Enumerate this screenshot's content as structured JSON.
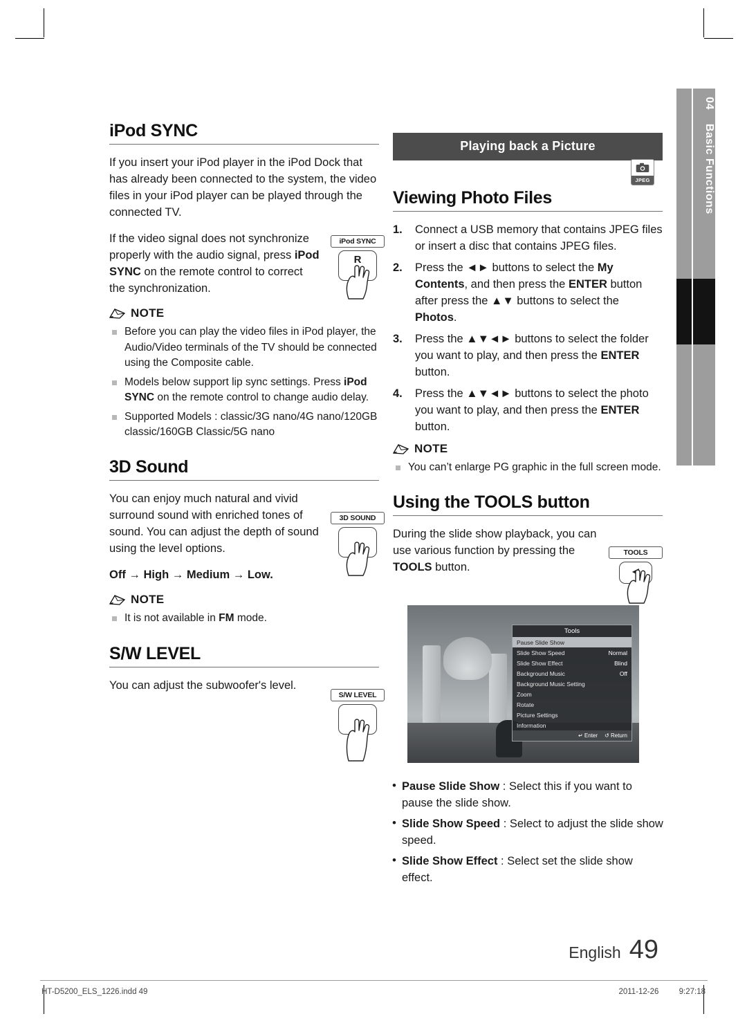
{
  "page": {
    "language_label": "English",
    "page_number": "49",
    "footer_file": "HT-D5200_ELS_1226.indd   49",
    "footer_date": "2011-12-26",
    "footer_time": "9:27:18"
  },
  "tab": {
    "chapter_number": "04",
    "chapter_title": "Basic Functions"
  },
  "left": {
    "ipod_sync": {
      "heading": "iPod SYNC",
      "para1": "If you insert your iPod player in the iPod Dock that has already been connected to the system, the video files in your iPod player can be played through the connected TV.",
      "para2_pre": "If the video signal does not synchronize properly with the audio signal, press ",
      "para2_bold": "iPod SYNC",
      "para2_post": " on the remote control to correct the synchronization.",
      "button_caption": "iPod SYNC",
      "note_label": "NOTE",
      "notes": [
        "Before you can play the video files in iPod player, the Audio/Video terminals of the TV should be connected using the Composite cable.",
        "Models below support lip sync settings. Press iPod SYNC on the remote control to change audio delay.",
        "Supported Models : classic/3G nano/4G nano/120GB classic/160GB Classic/5G nano"
      ],
      "note2_bold": "iPod SYNC"
    },
    "three_d_sound": {
      "heading": "3D Sound",
      "para": "You can enjoy much natural and vivid surround sound with enriched tones of sound. You can adjust the depth of sound using the level options.",
      "options": "Off → High → Medium → Low.",
      "button_caption": "3D SOUND",
      "note_label": "NOTE",
      "notes": [
        "It is not available in FM mode."
      ],
      "note_bold": "FM"
    },
    "sw_level": {
      "heading": "S/W LEVEL",
      "para": "You can adjust the subwoofer's level.",
      "button_caption": "S/W LEVEL"
    }
  },
  "right": {
    "banner": "Playing back a Picture",
    "badge": {
      "format": "JPEG",
      "icon": "photo-icon"
    },
    "viewing": {
      "heading": "Viewing Photo Files",
      "steps": [
        {
          "num": "1.",
          "parts": [
            {
              "t": "Connect a USB memory that contains JPEG files or insert a disc that contains JPEG files.",
              "b": false
            }
          ]
        },
        {
          "num": "2.",
          "parts": [
            {
              "t": "Press the ◄► buttons to select the ",
              "b": false
            },
            {
              "t": "My Contents",
              "b": true
            },
            {
              "t": ", and then press the ",
              "b": false
            },
            {
              "t": "ENTER",
              "b": true
            },
            {
              "t": " button after press the ▲▼ buttons to select the ",
              "b": false
            },
            {
              "t": "Photos",
              "b": true
            },
            {
              "t": ".",
              "b": false
            }
          ]
        },
        {
          "num": "3.",
          "parts": [
            {
              "t": "Press the ▲▼◄► buttons to select the folder you want to play, and then press the ",
              "b": false
            },
            {
              "t": "ENTER",
              "b": true
            },
            {
              "t": " button.",
              "b": false
            }
          ]
        },
        {
          "num": "4.",
          "parts": [
            {
              "t": "Press the ▲▼◄► buttons to select the photo you want to play, and then press the ",
              "b": false
            },
            {
              "t": "ENTER",
              "b": true
            },
            {
              "t": " button.",
              "b": false
            }
          ]
        }
      ],
      "note_label": "NOTE",
      "notes": [
        "You can’t enlarge PG graphic in the full screen mode."
      ]
    },
    "tools": {
      "heading": "Using the TOOLS button",
      "para_pre": "During the slide show playback, you can use various function by pressing the ",
      "para_bold": "TOOLS",
      "para_post": " button.",
      "button_caption": "TOOLS",
      "screenshot": {
        "menu_title": "Tools",
        "rows": [
          {
            "label": "Pause Slide Show",
            "value": "",
            "selected": true
          },
          {
            "label": "Slide Show Speed",
            "value": "Normal",
            "selected": false
          },
          {
            "label": "Slide Show Effect",
            "value": "Blind",
            "selected": false
          },
          {
            "label": "Background Music",
            "value": "Off",
            "selected": false
          },
          {
            "label": "Background Music Setting",
            "value": "",
            "selected": false
          },
          {
            "label": "Zoom",
            "value": "",
            "selected": false
          },
          {
            "label": "Rotate",
            "value": "",
            "selected": false
          },
          {
            "label": "Picture Settings",
            "value": "",
            "selected": false
          },
          {
            "label": "Information",
            "value": "",
            "selected": false
          }
        ],
        "footer_enter": "Enter",
        "footer_return": "Return"
      },
      "bullets": [
        {
          "bold": "Pause Slide Show",
          "rest": " : Select this if you want to pause the slide show."
        },
        {
          "bold": "Slide Show Speed",
          "rest": " : Select to adjust the slide show speed."
        },
        {
          "bold": "Slide Show Effect",
          "rest": " : Select set the slide show effect."
        }
      ]
    }
  }
}
